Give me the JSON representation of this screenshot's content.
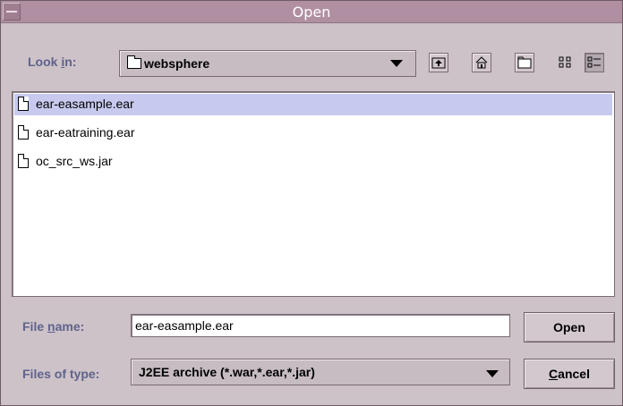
{
  "titlebar": {
    "title": "Open"
  },
  "look_in": {
    "label_pre": "Look ",
    "label_mnemonic": "i",
    "label_post": "n:",
    "value": "websphere"
  },
  "toolbar": {
    "up_icon": "up-one-level-icon",
    "home_icon": "home-icon",
    "new_folder_icon": "new-folder-icon",
    "list_view_icon": "list-view-icon",
    "details_view_icon": "details-view-icon"
  },
  "files": [
    {
      "name": "ear-easample.ear",
      "selected": true
    },
    {
      "name": "ear-eatraining.ear",
      "selected": false
    },
    {
      "name": "oc_src_ws.jar",
      "selected": false
    }
  ],
  "file_name": {
    "label_pre": "File ",
    "label_mnemonic": "n",
    "label_post": "ame:",
    "value": "ear-easample.ear"
  },
  "file_type": {
    "label": "Files of type:",
    "value": "J2EE archive (*.war,*.ear,*.jar)"
  },
  "buttons": {
    "open": "Open",
    "cancel_mnemonic": "C",
    "cancel_rest": "ancel"
  }
}
